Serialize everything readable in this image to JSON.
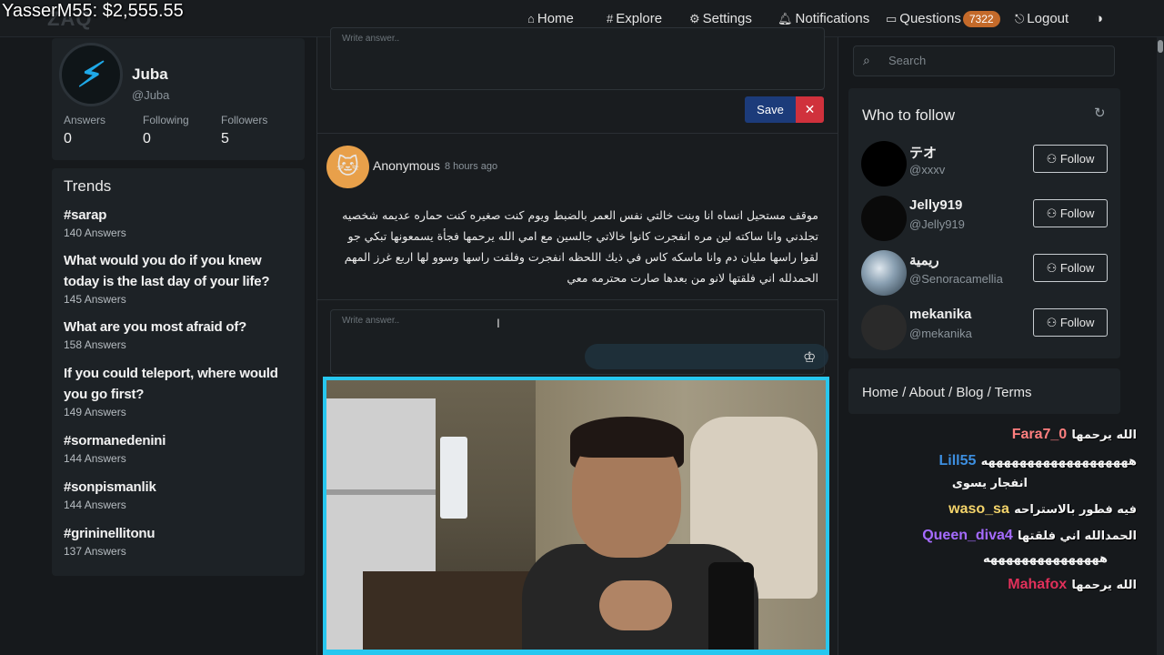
{
  "overlay": {
    "donation_text": "YasserM55: $2,555.55"
  },
  "nav": {
    "logo": "ZAQ",
    "home": "Home",
    "explore": "Explore",
    "settings": "Settings",
    "notifications": "Notifications",
    "questions": "Questions",
    "questions_count": "7322",
    "logout": "Logout"
  },
  "profile": {
    "name": "Juba",
    "handle": "@Juba",
    "answers_label": "Answers",
    "answers": "0",
    "following_label": "Following",
    "following": "0",
    "followers_label": "Followers",
    "followers": "5"
  },
  "trends": {
    "title": "Trends",
    "items": [
      {
        "title": "#sarap",
        "count": "140 Answers"
      },
      {
        "title": "What would you do if you knew today is the last day of your life?",
        "count": "145 Answers"
      },
      {
        "title": "What are you most afraid of?",
        "count": "158 Answers"
      },
      {
        "title": "If you could teleport, where would you go first?",
        "count": "149 Answers"
      },
      {
        "title": "#sormanedenini",
        "count": "144 Answers"
      },
      {
        "title": "#sonpismanlik",
        "count": "144 Answers"
      },
      {
        "title": "#grininellitonu",
        "count": "137 Answers"
      }
    ]
  },
  "feed": {
    "answer_placeholder": "Write answer..",
    "save": "Save",
    "cancel": "✕",
    "post": {
      "author": "Anonymous",
      "time": "8 hours ago",
      "text": "موقف مستحيل انساه انا وبنت خالتي نفس العمر بالضبط ويوم كنت صغيره كنت حماره عديمه شخصيه تجلدني وانا ساكته لين مره انفجرت كانوا خالاتي جالسين مع امي الله يرحمها فجأة يسمعونها تبكي جو لقوا راسها مليان دم وانا ماسكه كاس في ذيك اللحظه انفجرت وفلقت راسها وسوو لها اربع غرز المهم الحمدلله اني فلقتها لانو من بعدها صارت محترمه معي"
    }
  },
  "sidebar_right": {
    "search_placeholder": "Search",
    "who_to_follow": "Who to follow",
    "follow_label": "Follow",
    "users": [
      {
        "name": "テオ",
        "handle": "@xxxv"
      },
      {
        "name": "Jelly919",
        "handle": "@Jelly919"
      },
      {
        "name": "ريمية",
        "handle": "@Senoracamellia"
      },
      {
        "name": "mekanika",
        "handle": "@mekanika"
      }
    ],
    "footer_links": "Home / About / Blog / Terms"
  },
  "chat": [
    {
      "user": "Fara7_0",
      "color": "#ff7f7f",
      "message": "الله يرحمها"
    },
    {
      "user": "Lill55",
      "color": "#3d8fe0",
      "message": "هههههههههههههههههههه",
      "cont": "انفجار يسوى"
    },
    {
      "user": "waso_sa",
      "color": "#f3d36a",
      "message": "فيه فطور بالاستراحه"
    },
    {
      "user": "Queen_diva4",
      "color": "#a56bff",
      "message": "الحمدالله اني فلقتها",
      "cont": "هههههههههههههههه"
    },
    {
      "user": "Mahafox",
      "color": "#e0305a",
      "message": "الله يرحمها"
    }
  ],
  "colors": {
    "accent": "#27c7ef",
    "save_btn": "#1c3b7a",
    "cancel_btn": "#d0313c",
    "badge": "#c46a2a"
  }
}
